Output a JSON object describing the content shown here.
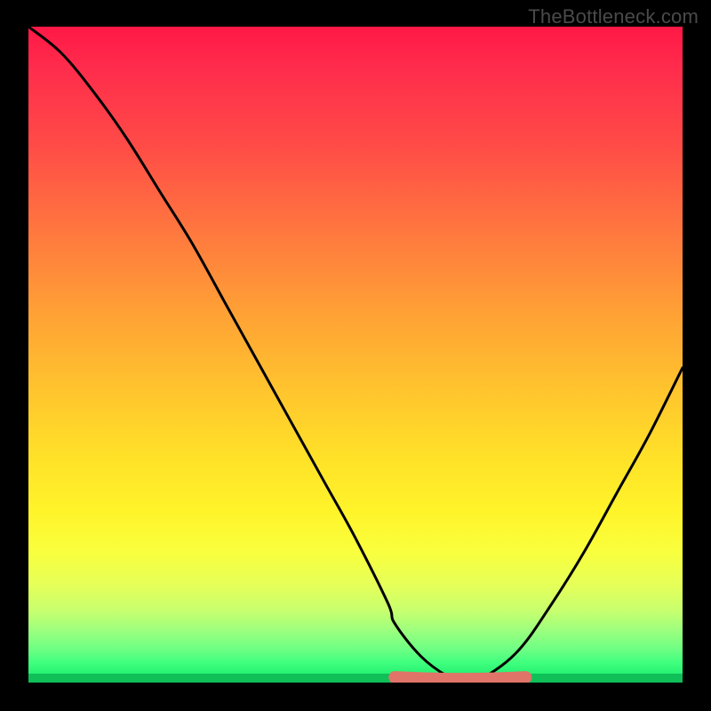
{
  "watermark": "TheBottleneck.com",
  "colors": {
    "curve": "#000000",
    "marker": "#e07468",
    "background_top": "#ff1846",
    "background_bottom": "#12e566"
  },
  "chart_data": {
    "type": "line",
    "title": "",
    "xlabel": "",
    "ylabel": "",
    "xlim": [
      0,
      100
    ],
    "ylim": [
      0,
      100
    ],
    "grid": false,
    "series": [
      {
        "name": "bottleneck_curve",
        "x": [
          0,
          5,
          10,
          15,
          20,
          25,
          30,
          35,
          40,
          45,
          50,
          55,
          56,
          60,
          64,
          67,
          70,
          75,
          80,
          85,
          90,
          95,
          100
        ],
        "y": [
          100,
          96,
          90,
          83,
          75,
          67,
          58,
          49,
          40,
          31,
          22,
          12,
          9,
          4,
          1,
          0,
          1,
          5,
          12,
          20,
          29,
          38,
          48
        ]
      }
    ],
    "marker": {
      "name": "optimal_range",
      "x_start": 56,
      "x_end": 76,
      "y": 0.8
    },
    "background_encoding": "vertical gradient: top=high bottleneck (red), bottom=low bottleneck (green)"
  }
}
